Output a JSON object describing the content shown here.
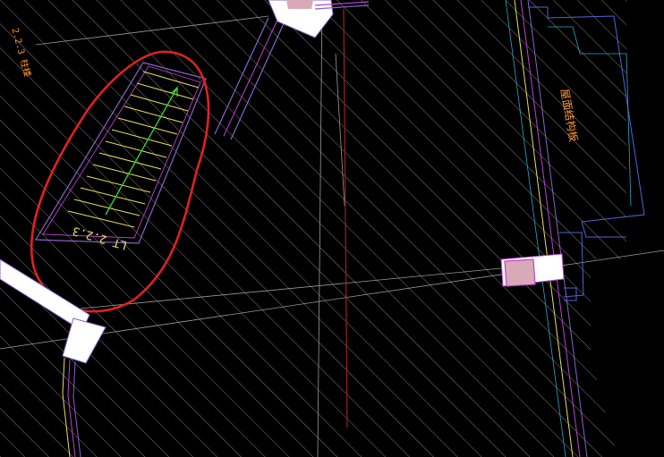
{
  "drawing": {
    "background": "#000000",
    "hatch_color": "#8a8a8a",
    "labels": {
      "left_edge": "2.2.3 柱楼",
      "right_room": "屋面结构板",
      "stair_mark": "LT 2.2.3"
    }
  },
  "colors": {
    "wall_outline": "#8a63c8",
    "wall_inner": "#c040d0",
    "stair_tread": "#e6e060",
    "stair_arrow": "#33dd33",
    "axis_line": "#a02020",
    "annotation": "#e02020",
    "text_orange": "#ff9a2e",
    "column_fill": "#ffffff",
    "column_highlight": "#d8aab8",
    "cyan_line": "#2aa8c8",
    "blue_line": "#5066d8"
  }
}
